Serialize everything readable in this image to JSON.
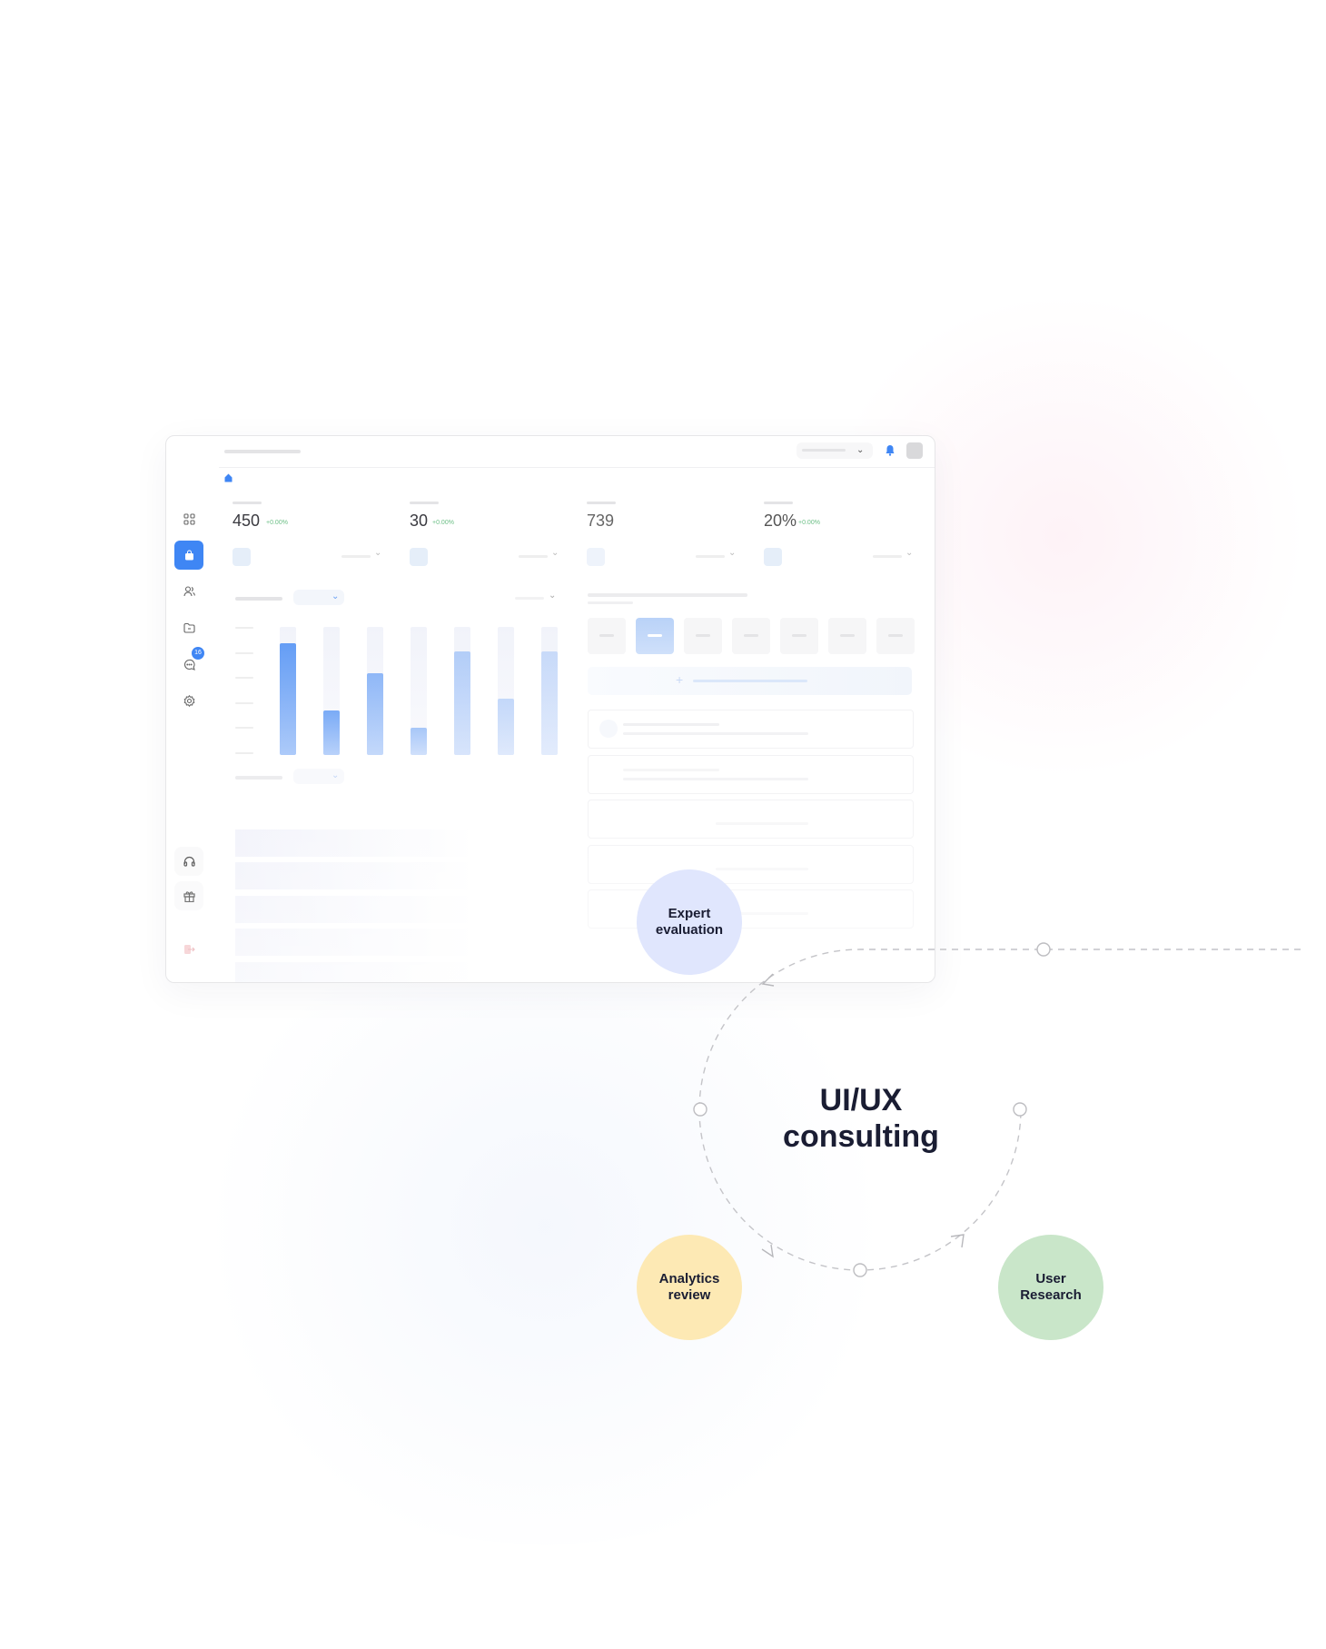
{
  "dashboard": {
    "sidebar": {
      "icons": [
        "grid-icon",
        "shopping-bag-icon",
        "users-icon",
        "folder-icon",
        "chat-icon",
        "gear-icon",
        "headset-icon",
        "gift-icon",
        "logout-icon"
      ],
      "active": "shopping-bag-icon",
      "chat_badge": "16"
    },
    "stats": [
      {
        "value": "450",
        "delta": "+0.00%"
      },
      {
        "value": "30",
        "delta": "+0.00%"
      },
      {
        "value": "739",
        "delta": ""
      },
      {
        "value": "20%",
        "delta": "+0.00%"
      }
    ],
    "bar_levels": [
      0.87,
      0.35,
      0.64,
      0.21,
      0.81,
      0.44,
      0.81
    ],
    "tiles_selected_index": 1,
    "colors": {
      "accent": "#3f86f4",
      "delta_green": "#6cbf86",
      "logout_red": "#f0b4b8"
    }
  },
  "diagram": {
    "title_line1": "UI/UX",
    "title_line2": "consulting",
    "nodes": [
      {
        "line1": "Expert",
        "line2": "evaluation",
        "color": "#e0e6fd"
      },
      {
        "line1": "Analytics",
        "line2": "review",
        "color": "#fde9b4"
      },
      {
        "line1": "User",
        "line2": "Research",
        "color": "#c9e6c9"
      }
    ]
  }
}
